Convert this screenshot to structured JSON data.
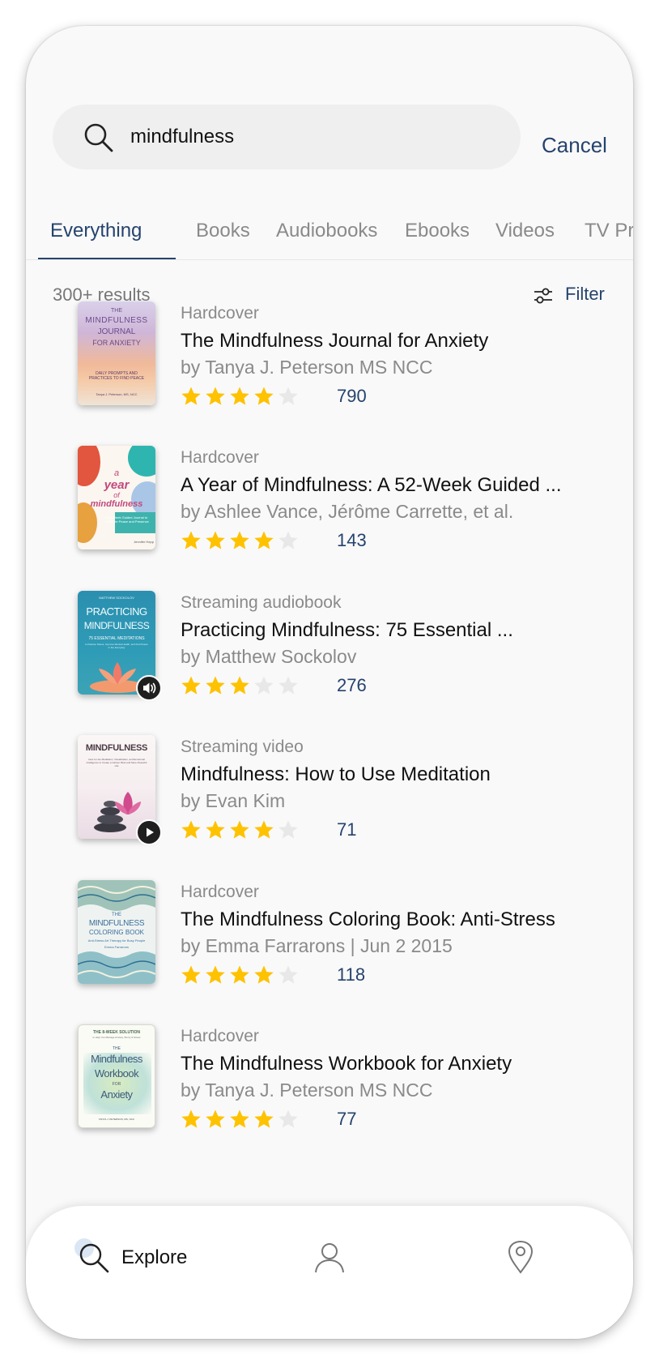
{
  "search": {
    "query": "mindfulness",
    "cancel_label": "Cancel"
  },
  "tabs": [
    {
      "label": "Everything",
      "active": true
    },
    {
      "label": "Books"
    },
    {
      "label": "Audiobooks"
    },
    {
      "label": "Ebooks"
    },
    {
      "label": "Videos"
    },
    {
      "label": "TV Pro"
    }
  ],
  "results": {
    "count_label": "300+ results",
    "filter_label": "Filter"
  },
  "items": [
    {
      "format": "Hardcover",
      "title": "The Mindfulness Journal for Anxiety",
      "author": "by Tanya J. Peterson MS NCC",
      "rating": 4,
      "count": "790",
      "cover": {
        "lines": [
          "THE",
          "MINDFULNESS",
          "JOURNAL",
          "FOR ANXIETY"
        ],
        "sub": "DAILY PROMPTS AND PRACTICES TO FIND PEACE",
        "byline": "Tanya J. Peterson, MS, NCC"
      }
    },
    {
      "format": "Hardcover",
      "title": "A Year of Mindfulness: A 52-Week Guided ...",
      "author": "by Ashlee Vance, Jérôme Carrette, et al.",
      "rating": 4,
      "count": "143",
      "cover": {
        "lines": [
          "a",
          "year",
          "of",
          "mindfulness"
        ],
        "sub": "A 52-Week Guided Journal to Cultivate Peace and Presence",
        "byline": "Jennifer Hepp"
      }
    },
    {
      "format": "Streaming audiobook",
      "title": "Practicing Mindfulness: 75 Essential ...",
      "author": "by Matthew Sockolov",
      "rating": 3,
      "count": "276",
      "badge": "audio",
      "cover": {
        "lines": [
          "MATTHEW SOCKOLOV",
          "PRACTICING",
          "MINDFULNESS"
        ],
        "sub": "75 ESSENTIAL MEDITATIONS",
        "byline": "to Reduce Stress, Improve Mental Health, and Find Peace in the Everyday"
      }
    },
    {
      "format": "Streaming video",
      "title": "Mindfulness: How to Use Meditation",
      "author": "by Evan Kim",
      "rating": 4,
      "count": "71",
      "badge": "video",
      "cover": {
        "lines": [
          "MINDFULNESS"
        ],
        "sub": "How to Use Meditation, Visualization, and Emotional Intelligence to Create a Calmer Mind and More Peaceful Life",
        "byline": ""
      }
    },
    {
      "format": "Hardcover",
      "title": "The Mindfulness Coloring Book: Anti-Stress",
      "author": "by Emma Farrarons | Jun 2 2015",
      "rating": 4,
      "count": "118",
      "cover": {
        "lines": [
          "THE",
          "MINDFULNESS",
          "COLORING BOOK"
        ],
        "sub": "Anti-Stress Art Therapy for Busy People",
        "byline": "Emma Farrarons"
      }
    },
    {
      "format": "Hardcover",
      "title": "The Mindfulness Workbook for Anxiety",
      "author": "by Tanya J. Peterson MS NCC",
      "rating": 4,
      "count": "77",
      "cover": {
        "lines": [
          "THE 8-WEEK SOLUTION",
          "THE",
          "Mindfulness",
          "Workbook",
          "FOR",
          "Anxiety"
        ],
        "sub": "to Help You Manage Anxiety, Worry & Stress",
        "byline": "TANYA J. PETERSON, MS, NCC"
      }
    }
  ],
  "nav": {
    "explore_label": "Explore"
  },
  "colors": {
    "accent": "#26436e",
    "star": "#fec200",
    "star_empty": "#e8e8e8",
    "muted": "#8a8a8a"
  },
  "icons": [
    "search-icon",
    "filter-sliders-icon",
    "star-icon",
    "speaker-icon",
    "play-icon",
    "profile-icon",
    "location-pin-icon"
  ]
}
